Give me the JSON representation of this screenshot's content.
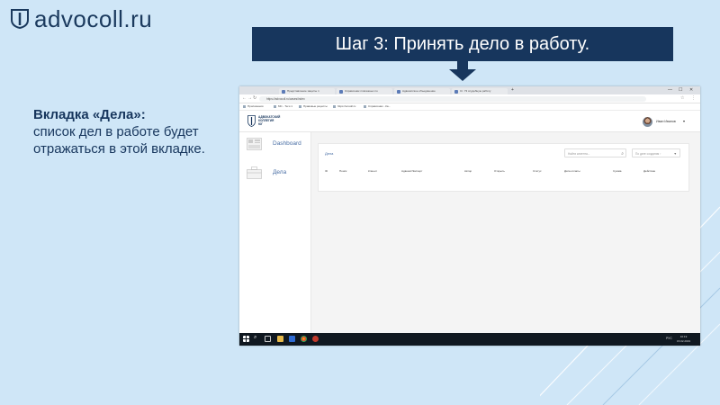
{
  "slide": {
    "logo_text": "advocoll.ru",
    "banner": "Шаг 3: Принять дело в работу.",
    "heading": "Вкладка «Дела»:",
    "body": "список дел в работе будет отражаться в этой вкладке."
  },
  "browser": {
    "tabs": [
      "Представление защиты п",
      "Справочник платежных по",
      "Адвокатское объединение",
      "Ст. 73 ссудебную работу"
    ],
    "url": "https://advocoll.ru/cases/index",
    "bookmarks": [
      "Приложения",
      "МС - Теги 1",
      "Правовые рецепты",
      "https://ensoll.ru",
      "Справочник - Ка..."
    ],
    "new_tab": "+",
    "window_controls": [
      "—",
      "☐",
      "✕"
    ]
  },
  "app": {
    "logo_lines": [
      "АДВОКАТСКИЙ",
      "КОЛЛЕГИЯ",
      "ЮГ"
    ],
    "user_name": "Иван Иванов",
    "sidebar": [
      {
        "label": "Dashboard",
        "icon": "dashboard-icon"
      },
      {
        "label": "Дела",
        "icon": "cases-icon"
      }
    ],
    "panel_title": "Дела",
    "search_placeholder": "Найти клиента...",
    "sort_label": "По дате создания ↑",
    "columns": [
      "ID",
      "Поиск",
      "Клиент",
      "Адвокат/Эксперт",
      "Автор",
      "Открыть",
      "Статус",
      "Дата оплаты",
      "Сумма",
      "Действие"
    ]
  },
  "taskbar": {
    "lang": "РУС",
    "time": "16:19",
    "date": "15.02.2019"
  },
  "colors": {
    "banner_bg": "#17365d",
    "slide_bg": "#cfe6f7",
    "link_blue": "#4a6fa5"
  }
}
